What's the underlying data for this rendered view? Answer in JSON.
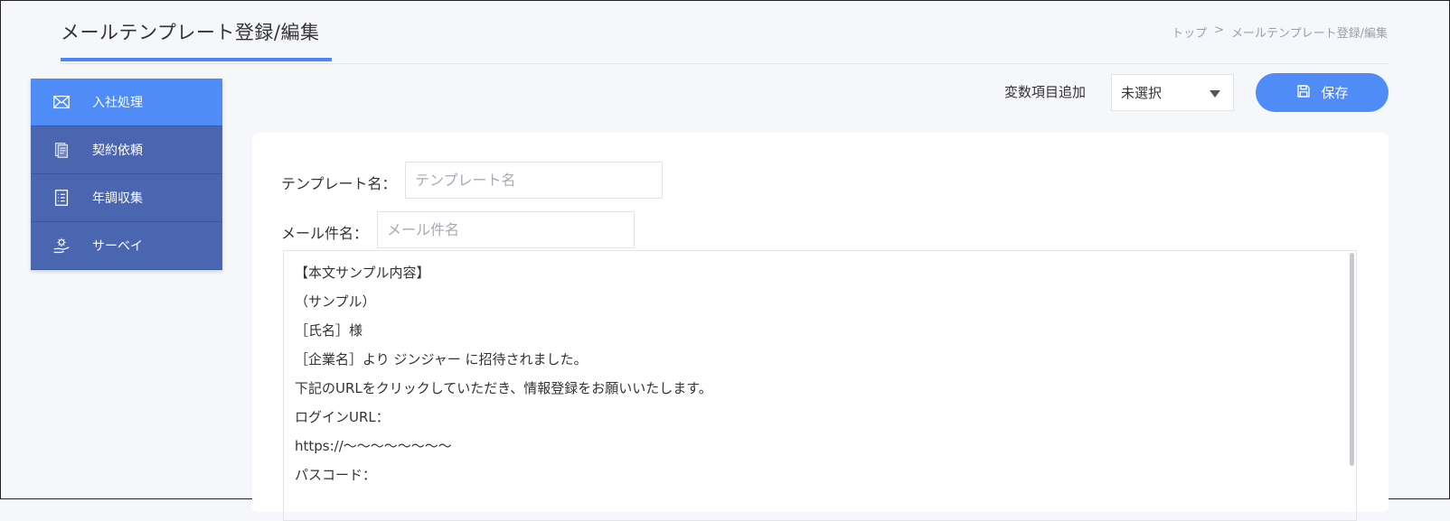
{
  "header": {
    "title": "メールテンプレート登録/編集",
    "breadcrumb": {
      "home": "トップ",
      "separator": ">",
      "current": "メールテンプレート登録/編集"
    }
  },
  "sidebar": {
    "items": [
      {
        "label": "入社処理",
        "icon": "mail-icon",
        "active": true
      },
      {
        "label": "契約依頼",
        "icon": "contract-icon",
        "active": false
      },
      {
        "label": "年調収集",
        "icon": "checklist-icon",
        "active": false
      },
      {
        "label": "サーベイ",
        "icon": "survey-icon",
        "active": false
      }
    ]
  },
  "toolbar": {
    "variable_label": "変数項目追加",
    "variable_select_value": "未選択",
    "save_label": "保存"
  },
  "form": {
    "template_name_label": "テンプレート名：",
    "template_name_placeholder": "テンプレート名",
    "subject_label": "メール件名：",
    "subject_placeholder": "メール件名",
    "body_lines": [
      "【本文サンプル内容】",
      "（サンプル）",
      "［氏名］様",
      "［企業名］より ジンジャー に招待されました。",
      "下記のURLをクリックしていただき、情報登録をお願いいたします。",
      "ログインURL：",
      "https://〜〜〜〜〜〜〜〜",
      "パスコード："
    ]
  },
  "colors": {
    "accent": "#4f8cf8",
    "sidebar_bg": "#4a66b0",
    "page_bg": "#f6f7fa"
  }
}
